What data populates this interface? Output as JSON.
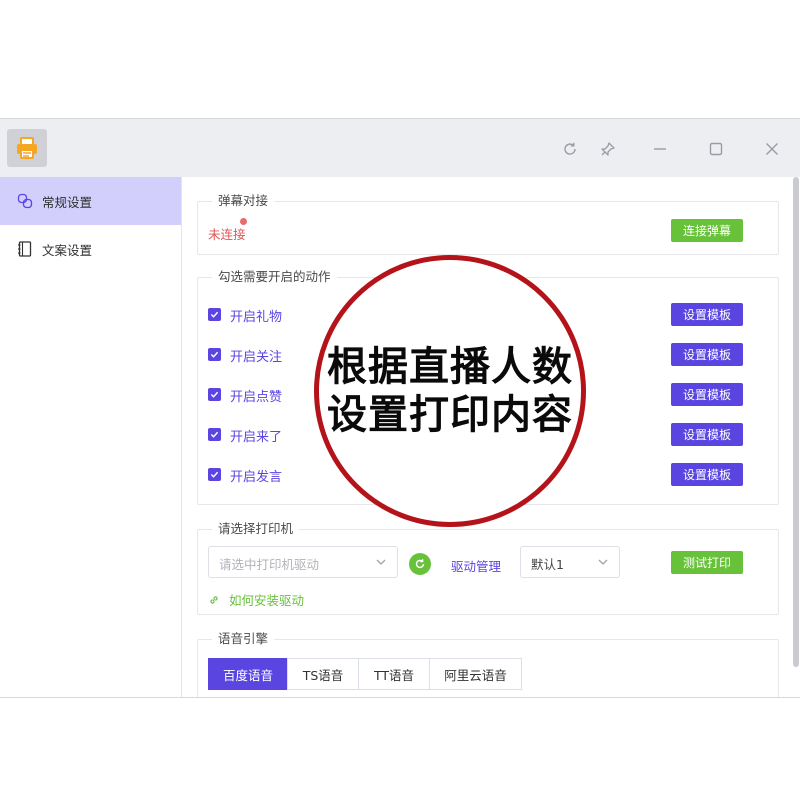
{
  "sidebar": {
    "items": [
      {
        "label": "常规设置",
        "icon": "link-icon",
        "active": true
      },
      {
        "label": "文案设置",
        "icon": "notebook-icon",
        "active": false
      }
    ]
  },
  "danmu": {
    "legend": "弹幕对接",
    "status": "未连接",
    "connect_label": "连接弹幕"
  },
  "actions": {
    "legend": "勾选需要开启的动作",
    "template_label": "设置模板",
    "items": [
      {
        "label": "开启礼物",
        "checked": true
      },
      {
        "label": "开启关注",
        "checked": true
      },
      {
        "label": "开启点赞",
        "checked": true
      },
      {
        "label": "开启来了",
        "checked": true
      },
      {
        "label": "开启发言",
        "checked": true
      }
    ]
  },
  "printer": {
    "legend": "请选择打印机",
    "driver_placeholder": "请选中打印机驱动",
    "driver_manage": "驱动管理",
    "default_value": "默认1",
    "test_print": "测试打印",
    "help_link": "如何安装驱动"
  },
  "voice": {
    "legend": "语音引擎",
    "tabs": [
      {
        "label": "百度语音",
        "active": true
      },
      {
        "label": "TS语音",
        "active": false
      },
      {
        "label": "TT语音",
        "active": false
      },
      {
        "label": "阿里云语音",
        "active": false
      }
    ]
  },
  "overlay": {
    "line1": "根据直播人数",
    "line2": "设置打印内容"
  },
  "colors": {
    "accent": "#5a45e0",
    "green": "#67c23a",
    "error": "#e15656",
    "overlay_ring": "#b5131a"
  }
}
